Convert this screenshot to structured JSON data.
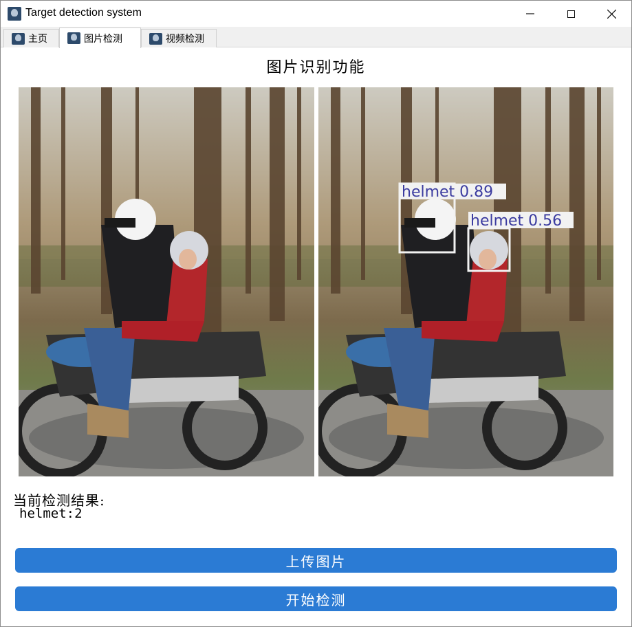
{
  "window": {
    "title": "Target detection system",
    "icons": [
      "app-icon",
      "minimize-icon",
      "maximize-icon",
      "close-icon"
    ]
  },
  "tabs": [
    {
      "label": "主页",
      "icon": "app-icon",
      "active": false
    },
    {
      "label": "图片检测",
      "icon": "app-icon",
      "active": true
    },
    {
      "label": "视频检测",
      "icon": "app-icon",
      "active": false
    }
  ],
  "page": {
    "heading": "图片识别功能"
  },
  "images": {
    "original": "motorcycle-riders-photo",
    "detected": "motorcycle-riders-photo-with-detections",
    "detections": [
      {
        "label": "helmet 0.89",
        "class": "helmet",
        "confidence": 0.89
      },
      {
        "label": "helmet 0.56",
        "class": "helmet",
        "confidence": 0.56
      }
    ]
  },
  "result": {
    "title": "当前检测结果:",
    "text": "helmet:2"
  },
  "buttons": {
    "upload": "上传图片",
    "detect": "开始检测"
  },
  "colors": {
    "button": "#2b7bd4",
    "detection_box": "#f2f2f2",
    "detection_text": "#3c3ca0"
  }
}
